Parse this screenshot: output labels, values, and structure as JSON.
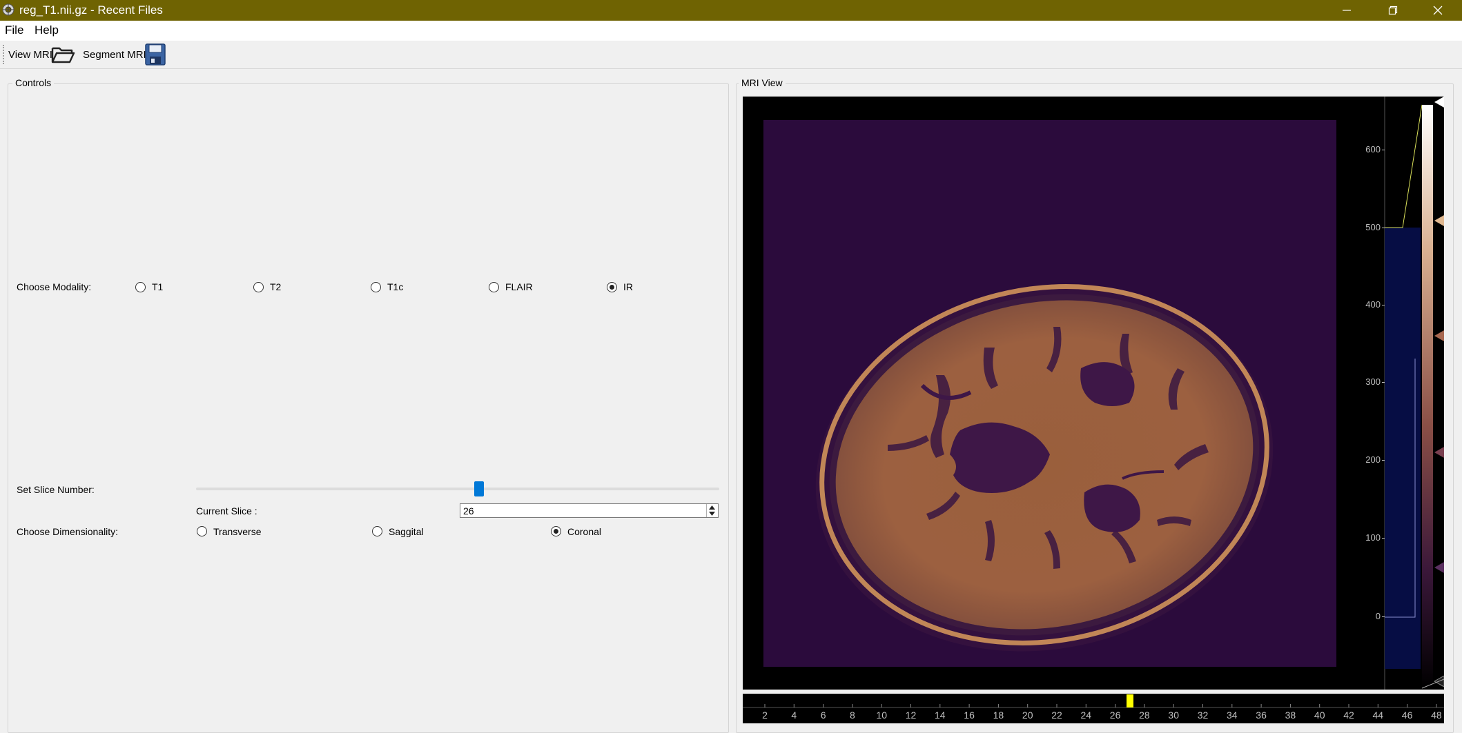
{
  "window": {
    "title": "reg_T1.nii.gz - Recent Files",
    "titlebar_color": "#6f6302"
  },
  "menu": {
    "items": [
      {
        "label": "File"
      },
      {
        "label": "Help"
      }
    ]
  },
  "toolbar": {
    "view_mri_label": "View MRI",
    "view_mri_icon": "folder-open-icon",
    "segment_mri_label": "Segment MRI",
    "segment_mri_icon": "floppy-disk-icon"
  },
  "controls": {
    "title": "Controls",
    "modality_label": "Choose Modality:",
    "modalities": [
      {
        "label": "T1",
        "checked": false
      },
      {
        "label": "T2",
        "checked": false
      },
      {
        "label": "T1c",
        "checked": false
      },
      {
        "label": "FLAIR",
        "checked": false
      },
      {
        "label": "IR",
        "checked": true
      }
    ],
    "slice_label": "Set Slice Number:",
    "slider_accent": "#0078d7",
    "current_slice_label": "Current Slice :",
    "current_slice_value": "26",
    "dimensionality_label": "Choose Dimensionality:",
    "dimensions": [
      {
        "label": "Transverse",
        "checked": false
      },
      {
        "label": "Saggital",
        "checked": false
      },
      {
        "label": "Coronal",
        "checked": true
      }
    ]
  },
  "mri_view": {
    "title": "MRI View",
    "histogram_ticks": [
      "600",
      "500",
      "400",
      "300",
      "200",
      "100",
      "0"
    ],
    "timeline_ticks": [
      "2",
      "4",
      "6",
      "8",
      "10",
      "12",
      "14",
      "16",
      "18",
      "20",
      "22",
      "24",
      "26",
      "28",
      "30",
      "32",
      "34",
      "36",
      "38",
      "40",
      "42",
      "44",
      "46",
      "48"
    ],
    "timeline_marker_color": "#ffff00"
  }
}
